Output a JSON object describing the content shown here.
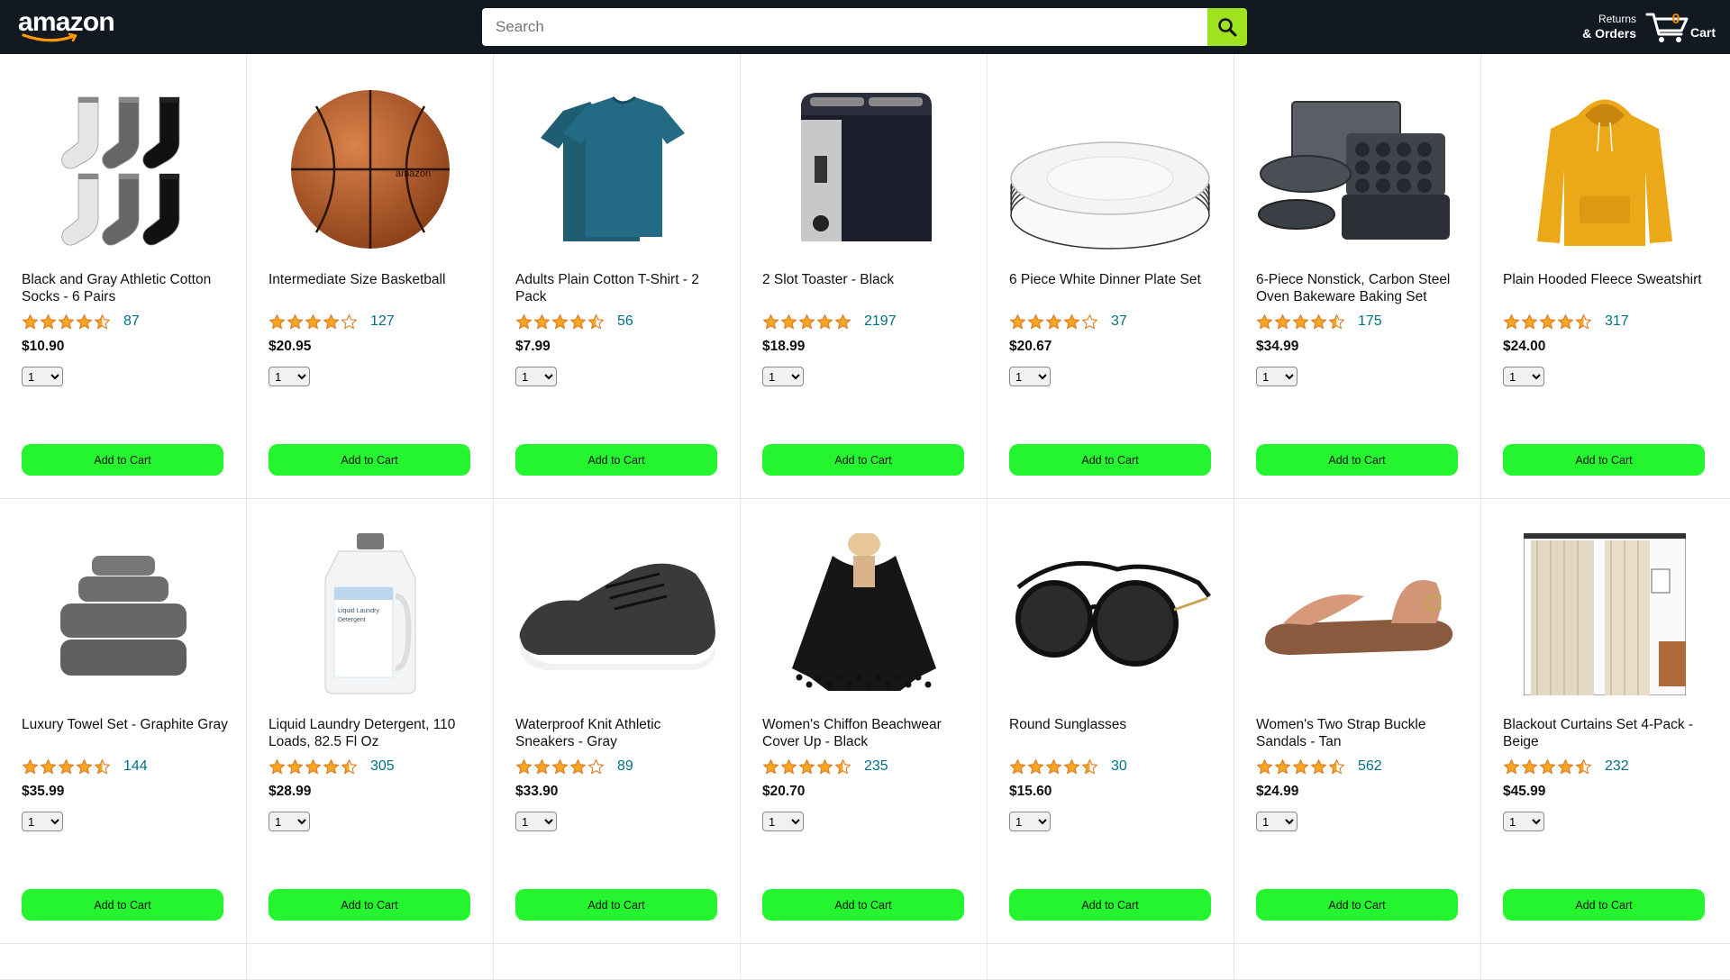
{
  "header": {
    "logo_text": "amazon",
    "search_placeholder": "Search",
    "returns_line1": "Returns",
    "returns_line2": "& Orders",
    "cart_count": "0",
    "cart_label": "Cart"
  },
  "colors": {
    "header_bg": "#131921",
    "search_button": "#9de31e",
    "add_to_cart": "#25f52e",
    "star": "#f5a623",
    "review_link": "#007185",
    "cart_count": "#f08804"
  },
  "products": [
    {
      "title": "Black and Gray Athletic Cotton Socks - 6 Pairs",
      "rating": 4.5,
      "reviews": "87",
      "price": "$10.90",
      "qty": "1",
      "button": "Add to Cart",
      "image_icon": "socks-icon"
    },
    {
      "title": "Intermediate Size Basketball",
      "rating": 4.0,
      "reviews": "127",
      "price": "$20.95",
      "qty": "1",
      "button": "Add to Cart",
      "image_icon": "basketball-icon"
    },
    {
      "title": "Adults Plain Cotton T-Shirt - 2 Pack",
      "rating": 4.5,
      "reviews": "56",
      "price": "$7.99",
      "qty": "1",
      "button": "Add to Cart",
      "image_icon": "tshirt-icon"
    },
    {
      "title": "2 Slot Toaster - Black",
      "rating": 5.0,
      "reviews": "2197",
      "price": "$18.99",
      "qty": "1",
      "button": "Add to Cart",
      "image_icon": "toaster-icon"
    },
    {
      "title": "6 Piece White Dinner Plate Set",
      "rating": 4.0,
      "reviews": "37",
      "price": "$20.67",
      "qty": "1",
      "button": "Add to Cart",
      "image_icon": "plates-icon"
    },
    {
      "title": "6-Piece Nonstick, Carbon Steel Oven Bakeware Baking Set",
      "rating": 4.5,
      "reviews": "175",
      "price": "$34.99",
      "qty": "1",
      "button": "Add to Cart",
      "image_icon": "bakeware-icon"
    },
    {
      "title": "Plain Hooded Fleece Sweatshirt",
      "rating": 4.5,
      "reviews": "317",
      "price": "$24.00",
      "qty": "1",
      "button": "Add to Cart",
      "image_icon": "hoodie-icon"
    },
    {
      "title": "Luxury Towel Set - Graphite Gray",
      "rating": 4.5,
      "reviews": "144",
      "price": "$35.99",
      "qty": "1",
      "button": "Add to Cart",
      "image_icon": "towels-icon"
    },
    {
      "title": "Liquid Laundry Detergent, 110 Loads, 82.5 Fl Oz",
      "rating": 4.5,
      "reviews": "305",
      "price": "$28.99",
      "qty": "1",
      "button": "Add to Cart",
      "image_icon": "detergent-icon"
    },
    {
      "title": "Waterproof Knit Athletic Sneakers - Gray",
      "rating": 4.0,
      "reviews": "89",
      "price": "$33.90",
      "qty": "1",
      "button": "Add to Cart",
      "image_icon": "sneaker-icon"
    },
    {
      "title": "Women's Chiffon Beachwear Cover Up - Black",
      "rating": 4.5,
      "reviews": "235",
      "price": "$20.70",
      "qty": "1",
      "button": "Add to Cart",
      "image_icon": "coverup-icon"
    },
    {
      "title": "Round Sunglasses",
      "rating": 4.5,
      "reviews": "30",
      "price": "$15.60",
      "qty": "1",
      "button": "Add to Cart",
      "image_icon": "sunglasses-icon"
    },
    {
      "title": "Women's Two Strap Buckle Sandals - Tan",
      "rating": 4.5,
      "reviews": "562",
      "price": "$24.99",
      "qty": "1",
      "button": "Add to Cart",
      "image_icon": "sandals-icon"
    },
    {
      "title": "Blackout Curtains Set 4-Pack - Beige",
      "rating": 4.5,
      "reviews": "232",
      "price": "$45.99",
      "qty": "1",
      "button": "Add to Cart",
      "image_icon": "curtains-icon"
    }
  ]
}
